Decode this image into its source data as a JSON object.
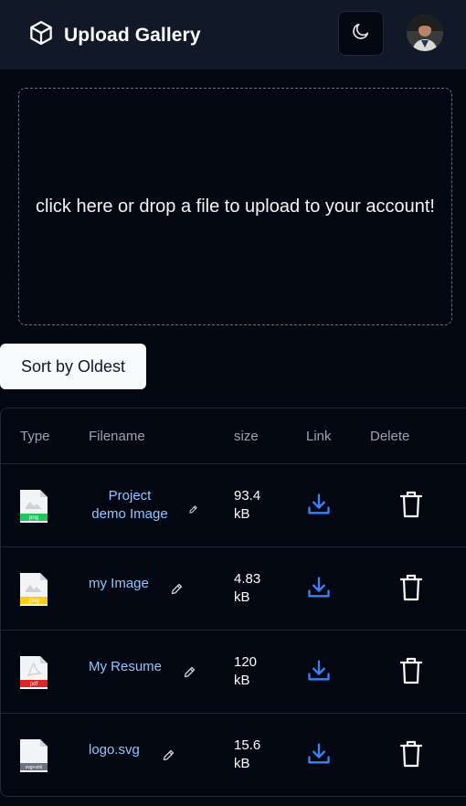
{
  "header": {
    "title": "Upload Gallery",
    "logo_icon": "cube-icon",
    "theme_toggle_icon": "moon-icon"
  },
  "dropzone": {
    "text": "click here or drop a file to upload to your account!"
  },
  "sort": {
    "label": "Sort by Oldest"
  },
  "table": {
    "columns": [
      "Type",
      "Filename",
      "size",
      "Link",
      "Delete"
    ],
    "rows": [
      {
        "type_badge": "png",
        "badge_color": "#22c55e",
        "filename_line1": "Project",
        "filename_line2": "demo Image",
        "size_value": "93.4",
        "size_unit": "kB"
      },
      {
        "type_badge": "jpeg",
        "badge_color": "#facc15",
        "filename_line1": "my Image",
        "size_value": "4.83",
        "size_unit": "kB"
      },
      {
        "type_badge": "pdf",
        "badge_color": "#dc2626",
        "filename_line1": "My Resume",
        "size_value": "120",
        "size_unit": "kB"
      },
      {
        "type_badge": "svg+xml",
        "badge_color": "#6b7280",
        "filename_line1": "logo.svg",
        "size_value": "15.6",
        "size_unit": "kB"
      }
    ]
  },
  "colors": {
    "accent": "#3b82f6",
    "link_text": "#93c5fd"
  }
}
